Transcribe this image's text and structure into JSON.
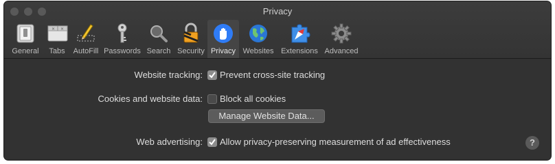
{
  "window": {
    "title": "Privacy"
  },
  "toolbar": {
    "tabs": [
      {
        "label": "General",
        "icon": "general-switch-icon"
      },
      {
        "label": "Tabs",
        "icon": "tabs-icon"
      },
      {
        "label": "AutoFill",
        "icon": "autofill-pencil-icon"
      },
      {
        "label": "Passwords",
        "icon": "key-icon"
      },
      {
        "label": "Search",
        "icon": "magnifier-icon"
      },
      {
        "label": "Security",
        "icon": "lock-icon"
      },
      {
        "label": "Privacy",
        "icon": "hand-icon"
      },
      {
        "label": "Websites",
        "icon": "globe-icon"
      },
      {
        "label": "Extensions",
        "icon": "puzzle-icon"
      },
      {
        "label": "Advanced",
        "icon": "gear-icon"
      }
    ],
    "selected_tab": "Privacy"
  },
  "settings": {
    "website_tracking": {
      "label": "Website tracking:",
      "option": "Prevent cross-site tracking",
      "checked": true
    },
    "cookies": {
      "label": "Cookies and website data:",
      "option": "Block all cookies",
      "checked": false,
      "button": "Manage Website Data..."
    },
    "advertising": {
      "label": "Web advertising:",
      "option": "Allow privacy-preserving measurement of ad effectiveness",
      "checked": true
    }
  },
  "help": {
    "glyph": "?"
  },
  "colors": {
    "accent_blue": "#2f7cf6",
    "window_bg": "#323232",
    "toolbar_bg": "#3a3a3a"
  }
}
